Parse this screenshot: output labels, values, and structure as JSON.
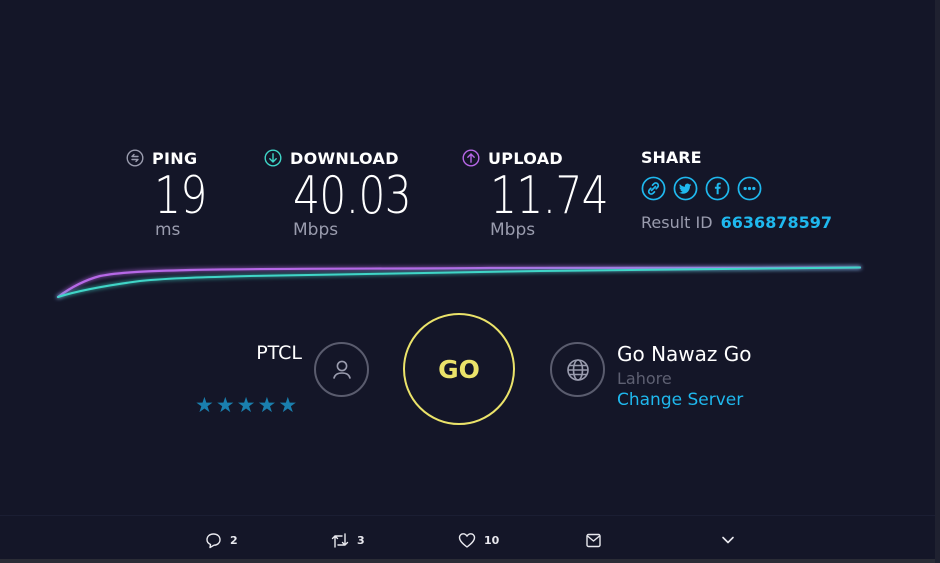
{
  "metrics": {
    "ping": {
      "label": "PING",
      "value": "19",
      "unit": "ms",
      "icon": "ping-icon",
      "color": "#9a9cae"
    },
    "download": {
      "label": "DOWNLOAD",
      "value": "40.03",
      "unit": "Mbps",
      "icon": "download-arrow-icon",
      "color": "#3fd5c7"
    },
    "upload": {
      "label": "UPLOAD",
      "value": "11.74",
      "unit": "Mbps",
      "icon": "upload-arrow-icon",
      "color": "#b667e6"
    }
  },
  "share": {
    "label": "SHARE",
    "icons": [
      "link-icon",
      "twitter-icon",
      "facebook-icon",
      "more-icon"
    ],
    "result_label": "Result ID",
    "result_id": "6636878597",
    "accent": "#1fb8ee"
  },
  "isp": {
    "name": "PTCL",
    "rating_stars": 5,
    "star_glyph": "★"
  },
  "go_button": {
    "label": "GO",
    "color": "#ebe36a"
  },
  "server": {
    "name": "Go Nawaz Go",
    "location": "Lahore",
    "change_label": "Change Server"
  },
  "tweet_actions": {
    "reply": {
      "icon": "reply-icon",
      "count": "2"
    },
    "retweet": {
      "icon": "retweet-icon",
      "count": "3"
    },
    "like": {
      "icon": "heart-icon",
      "count": "10"
    },
    "message": {
      "icon": "mail-icon"
    },
    "more": {
      "icon": "chevron-down-icon"
    }
  }
}
